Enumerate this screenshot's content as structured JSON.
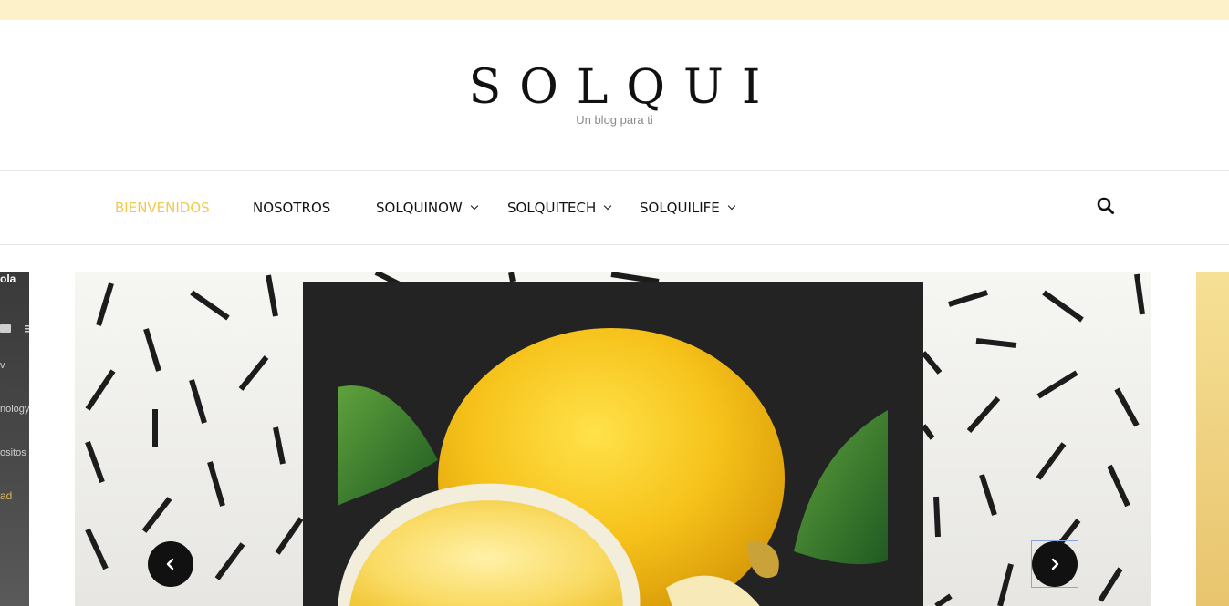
{
  "site": {
    "title": "SOLQUI",
    "tagline": "Un blog para ti"
  },
  "nav": {
    "items": [
      {
        "label": "BIENVENIDOS",
        "active": true,
        "has_dropdown": false
      },
      {
        "label": "NOSOTROS",
        "active": false,
        "has_dropdown": false
      },
      {
        "label": "SOLQUINOW",
        "active": false,
        "has_dropdown": true
      },
      {
        "label": "SOLQUITECH",
        "active": false,
        "has_dropdown": true
      },
      {
        "label": "SOLQUILIFE",
        "active": false,
        "has_dropdown": true
      }
    ],
    "search_icon": "search-icon"
  },
  "left_peek": {
    "lines": [
      "ola",
      "v",
      "nology",
      "ositos",
      "ad"
    ]
  },
  "slider": {
    "prev_icon": "chevron-left-icon",
    "next_icon": "chevron-right-icon"
  },
  "colors": {
    "topbar": "#fdf1c9",
    "accent": "#f0c94e",
    "text": "#111111",
    "panel": "#232323"
  }
}
